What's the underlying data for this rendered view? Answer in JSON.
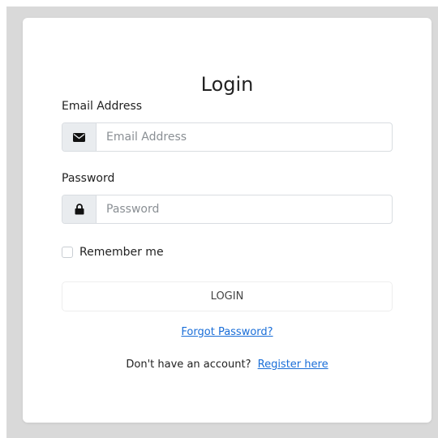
{
  "login": {
    "title": "Login",
    "email": {
      "label": "Email Address",
      "placeholder": "Email Address",
      "value": "",
      "icon": "envelope-icon"
    },
    "password": {
      "label": "Password",
      "placeholder": "Password",
      "value": "",
      "icon": "lock-icon"
    },
    "remember_label": "Remember me",
    "remember_checked": false,
    "submit_label": "LOGIN",
    "forgot_label": "Forgot Password?",
    "register_prompt": "Don't have an account?",
    "register_link": "Register here"
  },
  "colors": {
    "backdrop": "#d9d9d9",
    "card": "#ffffff",
    "link": "#1a6ed8",
    "addon_bg": "#e9ecef",
    "border": "#d9dde1"
  }
}
